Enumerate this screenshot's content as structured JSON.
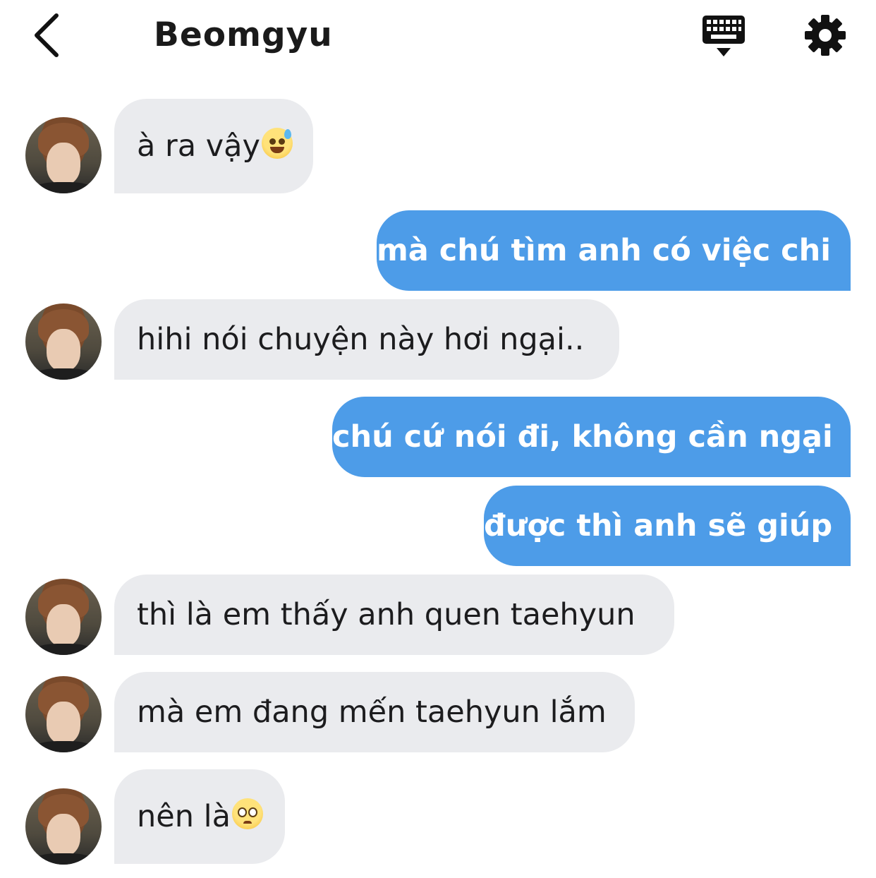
{
  "header": {
    "title": "Beomgyu",
    "back_icon": "chevron-left-icon",
    "keyboard_icon": "keyboard-icon",
    "settings_icon": "gear-icon"
  },
  "colors": {
    "outgoing_bubble": "#4d9ce8",
    "incoming_bubble": "#eaebee"
  },
  "messages": [
    {
      "side": "in",
      "text": "à ra vậy",
      "emoji": "sweat-smile-emoji"
    },
    {
      "side": "out",
      "text": "mà chú tìm anh có việc chi"
    },
    {
      "side": "in",
      "text": "hihi nói chuyện này hơi ngại.."
    },
    {
      "side": "out",
      "text": "chú cứ nói đi, không cần ngại "
    },
    {
      "side": "out",
      "text": "được thì anh sẽ giúp"
    },
    {
      "side": "in",
      "text": "thì là em thấy anh quen taehyun"
    },
    {
      "side": "in",
      "text": "mà em đang mến taehyun lắm"
    },
    {
      "side": "in",
      "text": "nên là",
      "emoji": "pleading-face-emoji"
    }
  ]
}
